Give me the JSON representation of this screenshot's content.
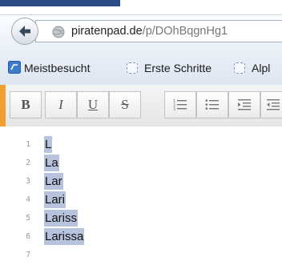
{
  "browser": {
    "url_host": "piratenpad.de",
    "url_path": "/p/DOhBqgnHg1",
    "bookmarks": [
      {
        "label": "Meistbesucht",
        "icon": "bookmark-site-icon"
      },
      {
        "label": "Erste Schritte",
        "icon": "bookmark-placeholder-icon"
      },
      {
        "label": "Alpl",
        "icon": "bookmark-placeholder-icon"
      }
    ]
  },
  "toolbar": {
    "bold_label": "B",
    "italic_label": "I",
    "underline_label": "U",
    "strikethrough_label": "S",
    "icons": [
      "ordered-list-icon",
      "unordered-list-icon",
      "indent-icon",
      "outdent-icon"
    ]
  },
  "editor": {
    "line_numbers": [
      "1",
      "2",
      "3",
      "4",
      "5",
      "6",
      "7"
    ],
    "lines": [
      "L",
      "La",
      "Lar",
      "Lari",
      "Lariss",
      "Larissa",
      ""
    ],
    "selection_color": "#b7c2dc"
  },
  "colors": {
    "accent_orange": "#f0a030",
    "tab_accent": "#2b4c87"
  }
}
